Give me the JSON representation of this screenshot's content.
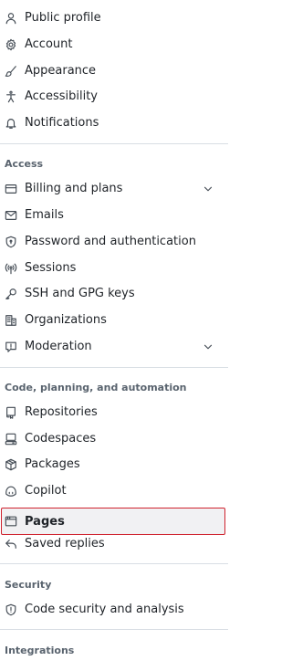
{
  "nav": {
    "group1": [
      {
        "label": "Public profile",
        "icon": "person-icon"
      },
      {
        "label": "Account",
        "icon": "gear-icon"
      },
      {
        "label": "Appearance",
        "icon": "paintbrush-icon"
      },
      {
        "label": "Accessibility",
        "icon": "accessibility-icon"
      },
      {
        "label": "Notifications",
        "icon": "bell-icon"
      }
    ],
    "access": {
      "heading": "Access",
      "items": [
        {
          "label": "Billing and plans",
          "icon": "credit-card-icon",
          "expandable": true
        },
        {
          "label": "Emails",
          "icon": "mail-icon"
        },
        {
          "label": "Password and authentication",
          "icon": "shield-lock-icon"
        },
        {
          "label": "Sessions",
          "icon": "broadcast-icon"
        },
        {
          "label": "SSH and GPG keys",
          "icon": "key-icon"
        },
        {
          "label": "Organizations",
          "icon": "organization-icon"
        },
        {
          "label": "Moderation",
          "icon": "report-icon",
          "expandable": true
        }
      ]
    },
    "code": {
      "heading": "Code, planning, and automation",
      "items": [
        {
          "label": "Repositories",
          "icon": "repo-icon"
        },
        {
          "label": "Codespaces",
          "icon": "codespaces-icon"
        },
        {
          "label": "Packages",
          "icon": "package-icon"
        },
        {
          "label": "Copilot",
          "icon": "copilot-icon"
        },
        {
          "label": "Pages",
          "icon": "browser-icon",
          "selected": true
        },
        {
          "label": "Saved replies",
          "icon": "reply-icon"
        }
      ]
    },
    "security": {
      "heading": "Security",
      "items": [
        {
          "label": "Code security and analysis",
          "icon": "shield-icon"
        }
      ]
    },
    "integrations": {
      "heading": "Integrations"
    }
  },
  "colors": {
    "selected_border": "#cf222e",
    "selected_bg": "#f1f1f3",
    "heading_text": "#59636e",
    "divider": "#d8dee4"
  }
}
